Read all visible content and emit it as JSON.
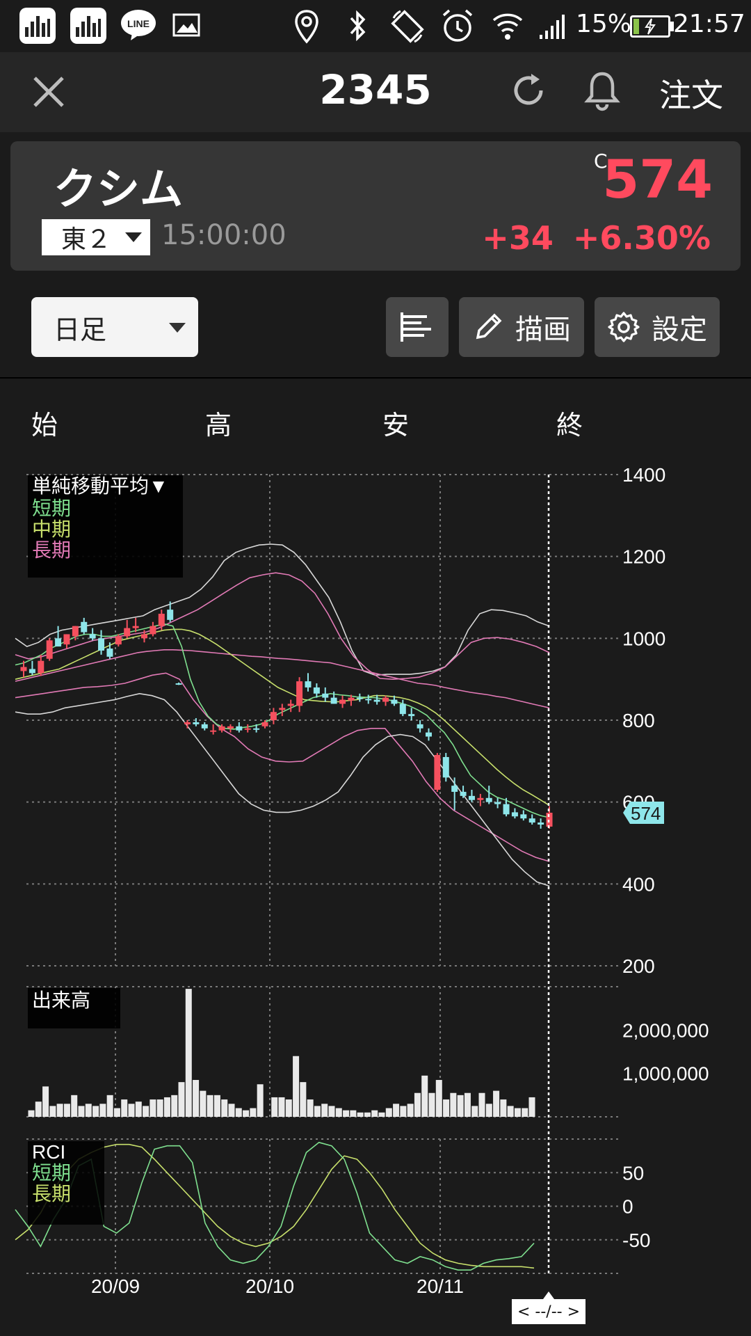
{
  "status_bar": {
    "battery_percent": "15%",
    "battery_level": 0.15,
    "time": "21:57",
    "icons": [
      "app-chart-icon",
      "app-chart-icon",
      "line-app-icon",
      "gallery-icon",
      "location-icon",
      "bluetooth-icon",
      "rotate-icon",
      "alarm-icon",
      "wifi-icon",
      "signal-icon",
      "battery-icon"
    ],
    "line_label": "LINE"
  },
  "header": {
    "code": "2345",
    "order_label": "注文",
    "icons": [
      "close-icon",
      "refresh-icon",
      "bell-icon"
    ]
  },
  "stock": {
    "name": "クシム",
    "market": "東２",
    "time": "15:00:00",
    "price_mark": "C",
    "price": "574",
    "change": "+34",
    "change_pct": "+6.30%",
    "up_color": "#ff4a5e"
  },
  "toolbar": {
    "period": "日足",
    "draw_label": "描画",
    "settings_label": "設定",
    "icons": [
      "bars-icon",
      "pencil-icon",
      "gear-icon"
    ]
  },
  "ohlc_labels": {
    "open": "始",
    "high": "高",
    "low": "安",
    "close": "終"
  },
  "nav": {
    "label": "< --/-- >"
  },
  "chart_data": {
    "type": "candlestick",
    "colors": {
      "up": "#f5505e",
      "down": "#8ee6ea",
      "short": "#7fe08f",
      "mid": "#c8e06c",
      "long": "#e27ab6",
      "band": "#d8d8d8"
    },
    "price_panel": {
      "ylim": [
        200,
        1400
      ],
      "yticks": [
        200,
        400,
        600,
        800,
        1000,
        1200,
        1400
      ],
      "legend_title": "単純移動平均▼",
      "legend_items": [
        "短期",
        "中期",
        "長期"
      ],
      "last_price_tag": "574"
    },
    "candles": [
      {
        "o": 920,
        "h": 945,
        "l": 905,
        "c": 930
      },
      {
        "o": 925,
        "h": 945,
        "l": 910,
        "c": 915
      },
      {
        "o": 915,
        "h": 960,
        "l": 908,
        "c": 945
      },
      {
        "o": 950,
        "h": 1000,
        "l": 945,
        "c": 995
      },
      {
        "o": 1000,
        "h": 1030,
        "l": 985,
        "c": 980
      },
      {
        "o": 985,
        "h": 1010,
        "l": 975,
        "c": 1010
      },
      {
        "o": 1005,
        "h": 1030,
        "l": 995,
        "c": 1030
      },
      {
        "o": 1040,
        "h": 1050,
        "l": 1010,
        "c": 1015
      },
      {
        "o": 1010,
        "h": 1025,
        "l": 995,
        "c": 1000
      },
      {
        "o": 1000,
        "h": 1020,
        "l": 960,
        "c": 970
      },
      {
        "o": 975,
        "h": 990,
        "l": 950,
        "c": 955
      },
      {
        "o": 985,
        "h": 1010,
        "l": 980,
        "c": 1005
      },
      {
        "o": 1005,
        "h": 1045,
        "l": 1000,
        "c": 1025
      },
      {
        "o": 1025,
        "h": 1050,
        "l": 1015,
        "c": 1030
      },
      {
        "o": 1000,
        "h": 1020,
        "l": 990,
        "c": 1010
      },
      {
        "o": 1010,
        "h": 1040,
        "l": 1005,
        "c": 1030
      },
      {
        "o": 1030,
        "h": 1070,
        "l": 1020,
        "c": 1060
      },
      {
        "o": 1070,
        "h": 1090,
        "l": 1040,
        "c": 1045
      },
      {
        "o": 890,
        "h": 892,
        "l": 886,
        "c": 888
      },
      {
        "o": 790,
        "h": 800,
        "l": 780,
        "c": 795
      },
      {
        "o": 795,
        "h": 805,
        "l": 785,
        "c": 790
      },
      {
        "o": 790,
        "h": 795,
        "l": 775,
        "c": 780
      },
      {
        "o": 775,
        "h": 790,
        "l": 765,
        "c": 775
      },
      {
        "o": 775,
        "h": 790,
        "l": 770,
        "c": 785
      },
      {
        "o": 780,
        "h": 790,
        "l": 770,
        "c": 785
      },
      {
        "o": 785,
        "h": 795,
        "l": 770,
        "c": 775
      },
      {
        "o": 780,
        "h": 790,
        "l": 770,
        "c": 780
      },
      {
        "o": 780,
        "h": 790,
        "l": 770,
        "c": 778
      },
      {
        "o": 785,
        "h": 800,
        "l": 780,
        "c": 795
      },
      {
        "o": 800,
        "h": 830,
        "l": 790,
        "c": 820
      },
      {
        "o": 825,
        "h": 840,
        "l": 810,
        "c": 830
      },
      {
        "o": 835,
        "h": 850,
        "l": 820,
        "c": 840
      },
      {
        "o": 835,
        "h": 905,
        "l": 820,
        "c": 895
      },
      {
        "o": 895,
        "h": 915,
        "l": 870,
        "c": 880
      },
      {
        "o": 880,
        "h": 890,
        "l": 855,
        "c": 865
      },
      {
        "o": 865,
        "h": 880,
        "l": 845,
        "c": 855
      },
      {
        "o": 855,
        "h": 870,
        "l": 840,
        "c": 840
      },
      {
        "o": 840,
        "h": 860,
        "l": 830,
        "c": 850
      },
      {
        "o": 848,
        "h": 862,
        "l": 835,
        "c": 855
      },
      {
        "o": 855,
        "h": 865,
        "l": 845,
        "c": 852
      },
      {
        "o": 852,
        "h": 862,
        "l": 840,
        "c": 850
      },
      {
        "o": 850,
        "h": 862,
        "l": 838,
        "c": 845
      },
      {
        "o": 845,
        "h": 860,
        "l": 835,
        "c": 855
      },
      {
        "o": 850,
        "h": 860,
        "l": 835,
        "c": 840
      },
      {
        "o": 840,
        "h": 850,
        "l": 810,
        "c": 815
      },
      {
        "o": 815,
        "h": 830,
        "l": 800,
        "c": 810
      },
      {
        "o": 790,
        "h": 800,
        "l": 770,
        "c": 780
      },
      {
        "o": 770,
        "h": 780,
        "l": 750,
        "c": 760
      },
      {
        "o": 630,
        "h": 720,
        "l": 625,
        "c": 715
      },
      {
        "o": 710,
        "h": 720,
        "l": 650,
        "c": 660
      },
      {
        "o": 640,
        "h": 660,
        "l": 580,
        "c": 625
      },
      {
        "o": 625,
        "h": 640,
        "l": 610,
        "c": 615
      },
      {
        "o": 615,
        "h": 630,
        "l": 600,
        "c": 605
      },
      {
        "o": 605,
        "h": 620,
        "l": 590,
        "c": 610
      },
      {
        "o": 610,
        "h": 640,
        "l": 595,
        "c": 600
      },
      {
        "o": 600,
        "h": 610,
        "l": 585,
        "c": 595
      },
      {
        "o": 595,
        "h": 610,
        "l": 565,
        "c": 570
      },
      {
        "o": 575,
        "h": 585,
        "l": 560,
        "c": 565
      },
      {
        "o": 570,
        "h": 580,
        "l": 555,
        "c": 560
      },
      {
        "o": 560,
        "h": 570,
        "l": 545,
        "c": 550
      },
      {
        "o": 550,
        "h": 560,
        "l": 535,
        "c": 545
      },
      {
        "o": 540,
        "h": 590,
        "l": 535,
        "c": 574
      }
    ],
    "ma_short": [
      935,
      940,
      950,
      960,
      975,
      985,
      995,
      1005,
      1010,
      1010,
      1005,
      1005,
      1010,
      1015,
      1020,
      1025,
      1030,
      1035,
      1030,
      980,
      900,
      845,
      810,
      790,
      780,
      778,
      782,
      785,
      790,
      800,
      815,
      825,
      835,
      845,
      855,
      860,
      865,
      862,
      860,
      857,
      856,
      855,
      852,
      848,
      842,
      835,
      825,
      812,
      790,
      770,
      740,
      700,
      665,
      645,
      625,
      612,
      605,
      595,
      585,
      575,
      567,
      562
    ],
    "ma_mid": [
      900,
      905,
      910,
      915,
      920,
      925,
      935,
      945,
      955,
      965,
      975,
      985,
      995,
      1000,
      1005,
      1010,
      1015,
      1020,
      1022,
      1022,
      1018,
      1010,
      998,
      985,
      970,
      955,
      940,
      925,
      910,
      895,
      880,
      870,
      860,
      850,
      848,
      846,
      845,
      845,
      848,
      850,
      855,
      860,
      860,
      858,
      855,
      850,
      842,
      832,
      818,
      800,
      780,
      760,
      740,
      720,
      700,
      680,
      662,
      645,
      630,
      618,
      605,
      592
    ],
    "ma_long": [
      895,
      900,
      905,
      910,
      915,
      920,
      925,
      930,
      935,
      940,
      945,
      950,
      955,
      960,
      965,
      968,
      970,
      972,
      972,
      971,
      970,
      968,
      966,
      964,
      962,
      960,
      958,
      956,
      955,
      953,
      951,
      950,
      948,
      946,
      944,
      942,
      940,
      935,
      930,
      925,
      920,
      915,
      910,
      905,
      900,
      895,
      890,
      888,
      885,
      880,
      876,
      872,
      868,
      865,
      862,
      858,
      855,
      850,
      845,
      840,
      835,
      830
    ],
    "bands": [
      {
        "name": "+2σ",
        "values": [
          1000,
          980,
          990,
          1010,
          1020,
          1025,
          1030,
          1035,
          1040,
          1045,
          1050,
          1055,
          1070,
          1080,
          1090,
          1100,
          1120,
          1150,
          1190,
          1210,
          1220,
          1228,
          1230,
          1228,
          1210,
          1180,
          1140,
          1100,
          1040,
          970,
          920,
          910,
          912,
          912,
          912,
          915,
          920,
          930,
          960,
          1020,
          1060,
          1070,
          1068,
          1062,
          1055,
          1040,
          1030
        ]
      },
      {
        "name": "+1σ",
        "values": [
          960,
          950,
          955,
          965,
          975,
          985,
          995,
          1000,
          1005,
          1010,
          1015,
          1025,
          1040,
          1055,
          1070,
          1090,
          1110,
          1130,
          1148,
          1155,
          1160,
          1155,
          1140,
          1110,
          1060,
          1000,
          955,
          925,
          902,
          900,
          902,
          905,
          915,
          930,
          960,
          990,
          1000,
          1002,
          998,
          990,
          980,
          965
        ]
      },
      {
        "name": "-1σ",
        "values": [
          855,
          860,
          865,
          870,
          875,
          880,
          882,
          885,
          890,
          900,
          910,
          915,
          900,
          850,
          810,
          780,
          760,
          730,
          710,
          700,
          698,
          700,
          720,
          740,
          760,
          775,
          780,
          780,
          740,
          700,
          650,
          610,
          580,
          560,
          540,
          520,
          500,
          480,
          465,
          455
        ]
      },
      {
        "name": "-2σ",
        "values": [
          820,
          815,
          815,
          820,
          830,
          835,
          840,
          845,
          850,
          858,
          865,
          860,
          850,
          820,
          780,
          740,
          700,
          660,
          620,
          595,
          580,
          575,
          575,
          580,
          590,
          605,
          625,
          665,
          710,
          740,
          760,
          765,
          760,
          740,
          700,
          660,
          620,
          580,
          540,
          500,
          460,
          430,
          405,
          395
        ]
      }
    ],
    "volume_panel": {
      "label": "出来高",
      "yticks": [
        1000000,
        2000000
      ],
      "ytick_labels": [
        "1,000,000",
        "2,000,000"
      ],
      "values": [
        150000,
        350000,
        700000,
        250000,
        300000,
        300000,
        500000,
        250000,
        300000,
        250000,
        300000,
        500000,
        200000,
        400000,
        300000,
        350000,
        250000,
        400000,
        400000,
        450000,
        500000,
        800000,
        2950000,
        850000,
        600000,
        500000,
        500000,
        400000,
        300000,
        200000,
        150000,
        200000,
        750000,
        0,
        450000,
        450000,
        400000,
        1400000,
        800000,
        400000,
        250000,
        300000,
        250000,
        200000,
        150000,
        150000,
        100000,
        100000,
        150000,
        100000,
        200000,
        300000,
        250000,
        300000,
        550000,
        950000,
        550000,
        850000,
        400000,
        550000,
        500000,
        550000,
        250000,
        550000,
        300000,
        600000,
        400000,
        250000,
        200000,
        200000,
        450000
      ],
      "volume_max": 3000000
    },
    "rci_panel": {
      "label": "RCI",
      "legend_items": [
        "短期",
        "長期"
      ],
      "ylim": [
        -100,
        100
      ],
      "yticks": [
        50,
        0,
        -50
      ],
      "short": [
        -5,
        -30,
        -60,
        -20,
        10,
        60,
        70,
        -30,
        -40,
        -25,
        35,
        85,
        90,
        90,
        65,
        -25,
        -60,
        -80,
        -85,
        -80,
        -60,
        -30,
        30,
        80,
        95,
        90,
        70,
        20,
        -40,
        -60,
        -80,
        -85,
        -75,
        -80,
        -90,
        -95,
        -95,
        -85,
        -80,
        -78,
        -75,
        -55
      ],
      "long": [
        -50,
        -35,
        -10,
        25,
        50,
        70,
        80,
        88,
        92,
        92,
        88,
        70,
        50,
        30,
        10,
        -10,
        -30,
        -45,
        -55,
        -60,
        -55,
        -45,
        -30,
        -5,
        25,
        55,
        75,
        70,
        50,
        25,
        -5,
        -30,
        -55,
        -70,
        -80,
        -85,
        -88,
        -90,
        -90,
        -90,
        -90,
        -92
      ],
      "x_labels": [
        "20/09",
        "20/10",
        "20/11"
      ]
    }
  }
}
